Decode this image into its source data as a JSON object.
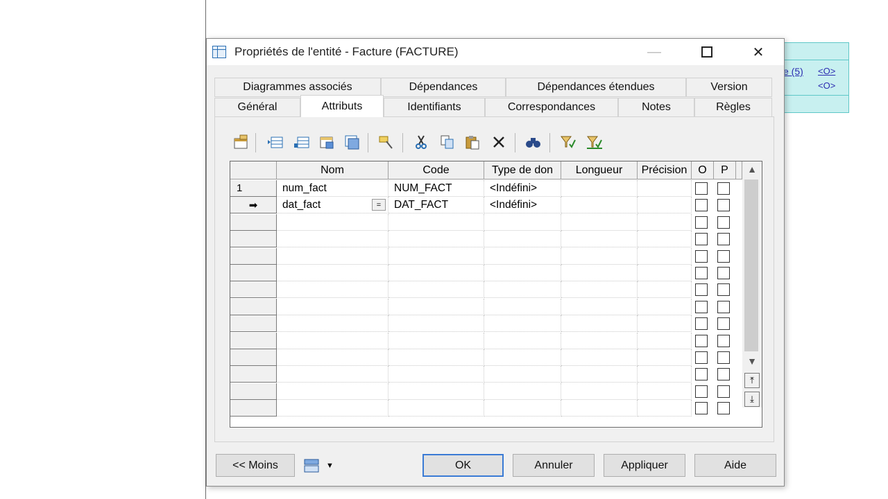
{
  "background": {
    "entity_text_1": "e (5)",
    "entity_text_2": "<O>",
    "entity_text_3": "<O>"
  },
  "window": {
    "title": "Propriétés de l'entité - Facture (FACTURE)",
    "minimize": "—",
    "close": "✕"
  },
  "tabs_row1": [
    "Diagrammes associés",
    "Dépendances",
    "Dépendances étendues",
    "Version"
  ],
  "tabs_row2": [
    "Général",
    "Attributs",
    "Identifiants",
    "Correspondances",
    "Notes",
    "Règles"
  ],
  "active_tab": "Attributs",
  "toolbar": {
    "icons": [
      "properties-icon",
      "insert-row-icon",
      "add-row-icon",
      "add-attributes-icon",
      "reuse-attributes-icon",
      "find-icon",
      "cut-icon",
      "copy-icon",
      "paste-icon",
      "delete-icon",
      "find-in-list-icon",
      "filter-icon",
      "clear-filter-icon"
    ]
  },
  "grid": {
    "columns": [
      "Nom",
      "Code",
      "Type de don",
      "Longueur",
      "Précision",
      "O",
      "P"
    ],
    "rows": [
      {
        "marker": "1",
        "nom": "num_fact",
        "code": "NUM_FACT",
        "type": "<Indéfini>",
        "longueur": "",
        "precision": ""
      },
      {
        "marker": "➡",
        "nom": "dat_fact",
        "code": "DAT_FACT",
        "type": "<Indéfini>",
        "longueur": "",
        "precision": ""
      }
    ],
    "ellipsis": "="
  },
  "buttons": {
    "moins": "<< Moins",
    "ok": "OK",
    "annuler": "Annuler",
    "appliquer": "Appliquer",
    "aide": "Aide"
  }
}
